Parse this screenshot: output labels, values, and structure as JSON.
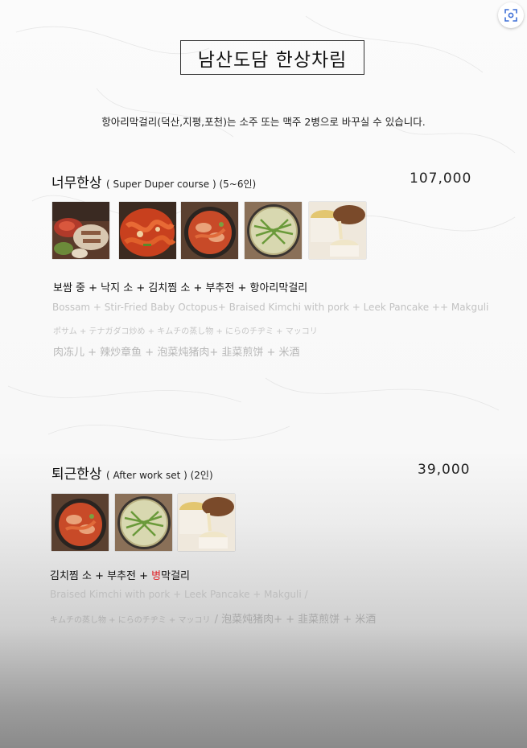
{
  "title": "남산도담 한상차림",
  "note": "항아리막걸리(덕산,지평,포천)는 소주 또는 맥주 2병으로 바꾸실 수 있습니다.",
  "courses": [
    {
      "name": "너무한상",
      "subtitle": "( Super Duper course ) (5~6인)",
      "price": "107,000",
      "photos": [
        "bossam-photo",
        "octopus-photo",
        "kimchi-stew-photo",
        "leek-pancake-photo",
        "makgeolli-photo"
      ],
      "korean": "보쌈 중 + 낙지 소 + 김치찜 소 + 부추전 +  항아리막걸리",
      "english": "Bossam + Stir-Fried Baby Octopus+  Braised Kimchi with pork +  Leek Pancake  ++ Makguli",
      "japanese": "ポサム +  テナガダコ炒め  +  キムチの蒸し物 +  にらのチヂミ +    マッコリ",
      "chinese": "肉冻儿 +  辣炒章鱼 +  泡菜炖猪肉+  韭菜煎饼  +  米酒"
    },
    {
      "name": "퇴근한상",
      "subtitle": "( After work set )   (2인)",
      "price": "39,000",
      "photos": [
        "kimchi-stew-photo",
        "leek-pancake-photo",
        "makgeolli-photo"
      ],
      "korean_prefix": "김치찜 소 + 부추전 + ",
      "korean_highlight": "병",
      "korean_suffix": "막걸리",
      "english": "Braised Kimchi with pork +  Leek  Pancake   + Makguli    /",
      "japanese": "キムチの蒸し物 +    にらのチヂミ + マッコリ",
      "chinese": "/   泡菜炖猪肉+  +  韭菜煎饼  + 米酒"
    }
  ],
  "colors": {
    "highlight": "#e0262b",
    "faded_text": "#c2c2c2"
  }
}
